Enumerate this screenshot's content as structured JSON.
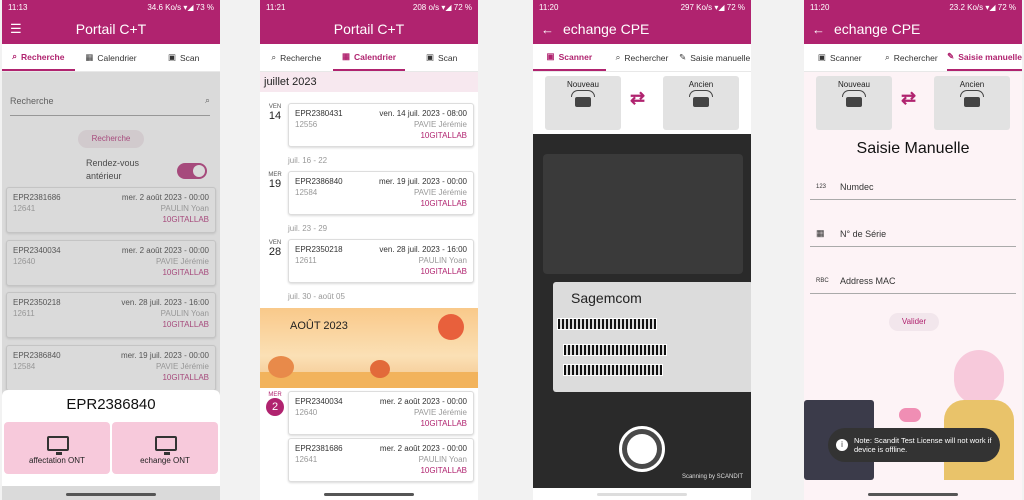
{
  "colors": {
    "brand": "#b0236f",
    "pink_light": "#f7c9db"
  },
  "phone1": {
    "status": {
      "time": "11:13",
      "right": "34.6 Ko/s ▾◢ 73 %"
    },
    "title": "Portail C+T",
    "tabs": [
      "Recherche",
      "Calendrier",
      "Scan"
    ],
    "search_placeholder": "Recherche",
    "search_button": "Recherche",
    "toggle_label": "Rendez-vous antérieur",
    "cards": [
      {
        "id": "EPR2381686",
        "date": "mer. 2 août 2023 - 00:00",
        "num": "12641",
        "name": "PAULIN Yoan",
        "group": "10GITALLAB"
      },
      {
        "id": "EPR2340034",
        "date": "mer. 2 août 2023 - 00:00",
        "num": "12640",
        "name": "PAVIE Jérémie",
        "group": "10GITALLAB"
      },
      {
        "id": "EPR2350218",
        "date": "ven. 28 juil. 2023 - 16:00",
        "num": "12611",
        "name": "PAULIN Yoan",
        "group": "10GITALLAB"
      },
      {
        "id": "EPR2386840",
        "date": "mer. 19 juil. 2023 - 00:00",
        "num": "12584",
        "name": "PAVIE Jérémie",
        "group": "10GITALLAB"
      }
    ],
    "sheet": {
      "title": "EPR2386840",
      "opt1": "affectation ONT",
      "opt2": "echange ONT"
    }
  },
  "phone2": {
    "status": {
      "time": "11:21",
      "right": "208 o/s ▾◢ 72 %"
    },
    "title": "Portail C+T",
    "tabs": [
      "Recherche",
      "Calendrier",
      "Scan"
    ],
    "month": "juillet 2023",
    "weeks": [
      "juil. 16 - 22",
      "juil. 23 - 29",
      "juil. 30 - août 05"
    ],
    "banner": "AOÛT 2023",
    "days": [
      {
        "dw": "VEN",
        "dn": "14"
      },
      {
        "dw": "MER",
        "dn": "19"
      },
      {
        "dw": "VEN",
        "dn": "28"
      },
      {
        "dw": "MER",
        "dn": "2"
      }
    ],
    "cards": [
      {
        "id": "EPR2380431",
        "date": "ven. 14 juil. 2023 - 08:00",
        "num": "12556",
        "name": "PAVIE Jérémie",
        "group": "10GITALLAB"
      },
      {
        "id": "EPR2386840",
        "date": "mer. 19 juil. 2023 - 00:00",
        "num": "12584",
        "name": "PAVIE Jérémie",
        "group": "10GITALLAB"
      },
      {
        "id": "EPR2350218",
        "date": "ven. 28 juil. 2023 - 16:00",
        "num": "12611",
        "name": "PAULIN Yoan",
        "group": "10GITALLAB"
      },
      {
        "id": "EPR2340034",
        "date": "mer. 2 août 2023 - 00:00",
        "num": "12640",
        "name": "PAVIE Jérémie",
        "group": "10GITALLAB"
      },
      {
        "id": "EPR2381686",
        "date": "mer. 2 août 2023 - 00:00",
        "num": "12641",
        "name": "PAULIN Yoan",
        "group": "10GITALLAB"
      }
    ]
  },
  "phone3": {
    "status": {
      "time": "11:20",
      "right": "297 Ko/s ▾◢ 72 %"
    },
    "title": "echange CPE",
    "tabs": [
      "Scanner",
      "Rechercher",
      "Saisie manuelle"
    ],
    "nouveau": "Nouveau",
    "ancien": "Ancien",
    "brand": "Sagemcom",
    "footer": "Scanning by SCANDIT"
  },
  "phone4": {
    "status": {
      "time": "11:20",
      "right": "23.2 Ko/s ▾◢ 72 %"
    },
    "title": "echange CPE",
    "tabs": [
      "Scanner",
      "Rechercher",
      "Saisie manuelle"
    ],
    "nouveau": "Nouveau",
    "ancien": "Ancien",
    "heading": "Saisie Manuelle",
    "fields": [
      {
        "icon": "123",
        "label": "Numdec"
      },
      {
        "icon": "▦",
        "label": "N° de Série"
      },
      {
        "icon": "RBC",
        "label": "Address MAC"
      }
    ],
    "validate": "Valider",
    "toast": "Note: Scandit Test License will not work if device is offline."
  }
}
